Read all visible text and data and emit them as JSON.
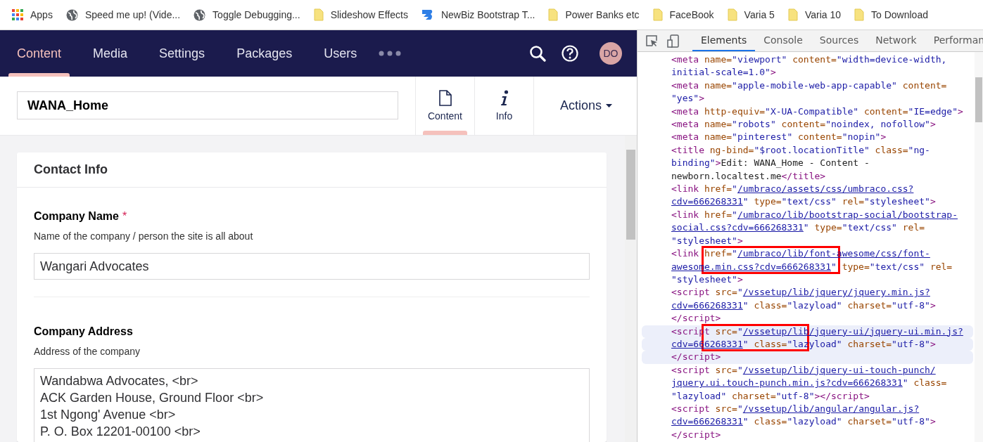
{
  "bookmarks": [
    {
      "kind": "apps",
      "label": "Apps"
    },
    {
      "kind": "page",
      "label": "Speed me up! (Vide..."
    },
    {
      "kind": "page",
      "label": "Toggle Debugging..."
    },
    {
      "kind": "folder",
      "label": "Slideshow Effects"
    },
    {
      "kind": "site",
      "label": "NewBiz Bootstrap T..."
    },
    {
      "kind": "folder",
      "label": "Power Banks etc"
    },
    {
      "kind": "folder",
      "label": "FaceBook"
    },
    {
      "kind": "folder",
      "label": "Varia 5"
    },
    {
      "kind": "folder",
      "label": "Varia 10"
    },
    {
      "kind": "folder",
      "label": "To Download"
    }
  ],
  "nav": {
    "items": [
      {
        "label": "Content",
        "selected": true
      },
      {
        "label": "Media",
        "selected": false
      },
      {
        "label": "Settings",
        "selected": false
      },
      {
        "label": "Packages",
        "selected": false
      },
      {
        "label": "Users",
        "selected": false
      }
    ],
    "avatar": "DO"
  },
  "editor": {
    "name": "WANA_Home",
    "apps": [
      {
        "label": "Content",
        "kind": "document",
        "selected": true
      },
      {
        "label": "Info",
        "kind": "info",
        "selected": false
      }
    ],
    "actions": "Actions"
  },
  "group": {
    "title": "Contact Info",
    "properties": [
      {
        "kind": "text",
        "label": "Company Name",
        "required_mark": "*",
        "description": "Name of the company / person the site is all about",
        "value": "Wangari Advocates"
      },
      {
        "kind": "textarea",
        "label": "Company Address",
        "description": "Address of the company",
        "value": "Wandabwa Advocates, <br>\nACK Garden House, Ground Floor <br>\n1st Ngong' Avenue <br>\nP. O. Box 12201-00100 <br>"
      }
    ]
  },
  "devtools": {
    "tabs": [
      {
        "label": "Elements",
        "selected": true
      },
      {
        "label": "Console",
        "selected": false
      },
      {
        "label": "Sources",
        "selected": false
      },
      {
        "label": "Network",
        "selected": false
      },
      {
        "label": "Performan",
        "selected": false
      }
    ],
    "lines": [
      {
        "selected": false,
        "tokens": [
          {
            "kind": "tag",
            "text": "<meta"
          },
          {
            "kind": "attr",
            "text": " name="
          },
          {
            "kind": "val",
            "text": "\"viewport\""
          },
          {
            "kind": "attr",
            "text": " content="
          },
          {
            "kind": "val",
            "text": "\"width=device-width,"
          }
        ]
      },
      {
        "selected": false,
        "tokens": [
          {
            "kind": "val",
            "text": "initial-scale=1.0\""
          },
          {
            "kind": "tag",
            "text": ">"
          }
        ]
      },
      {
        "selected": false,
        "tokens": [
          {
            "kind": "tag",
            "text": "<meta"
          },
          {
            "kind": "attr",
            "text": " name="
          },
          {
            "kind": "val",
            "text": "\"apple-mobile-web-app-capable\""
          },
          {
            "kind": "attr",
            "text": " content="
          }
        ]
      },
      {
        "selected": false,
        "tokens": [
          {
            "kind": "val",
            "text": "\"yes\""
          },
          {
            "kind": "tag",
            "text": ">"
          }
        ]
      },
      {
        "selected": false,
        "tokens": [
          {
            "kind": "tag",
            "text": "<meta"
          },
          {
            "kind": "attr",
            "text": " http-equiv="
          },
          {
            "kind": "val",
            "text": "\"X-UA-Compatible\""
          },
          {
            "kind": "attr",
            "text": " content="
          },
          {
            "kind": "val",
            "text": "\"IE=edge\""
          },
          {
            "kind": "tag",
            "text": ">"
          }
        ]
      },
      {
        "selected": false,
        "tokens": [
          {
            "kind": "tag",
            "text": "<meta"
          },
          {
            "kind": "attr",
            "text": " name="
          },
          {
            "kind": "val",
            "text": "\"robots\""
          },
          {
            "kind": "attr",
            "text": " content="
          },
          {
            "kind": "val",
            "text": "\"noindex, nofollow\""
          },
          {
            "kind": "tag",
            "text": ">"
          }
        ]
      },
      {
        "selected": false,
        "tokens": [
          {
            "kind": "tag",
            "text": "<meta"
          },
          {
            "kind": "attr",
            "text": " name="
          },
          {
            "kind": "val",
            "text": "\"pinterest\""
          },
          {
            "kind": "attr",
            "text": " content="
          },
          {
            "kind": "val",
            "text": "\"nopin\""
          },
          {
            "kind": "tag",
            "text": ">"
          }
        ]
      },
      {
        "selected": false,
        "tokens": [
          {
            "kind": "tag",
            "text": "<title"
          },
          {
            "kind": "attr",
            "text": " ng-bind="
          },
          {
            "kind": "val",
            "text": "\"$root.locationTitle\""
          },
          {
            "kind": "attr",
            "text": " class="
          },
          {
            "kind": "val",
            "text": "\"ng-"
          }
        ]
      },
      {
        "selected": false,
        "tokens": [
          {
            "kind": "val",
            "text": "binding\""
          },
          {
            "kind": "tag",
            "text": ">"
          },
          {
            "kind": "text",
            "text": "Edit: WANA_Home - Content -"
          }
        ]
      },
      {
        "selected": false,
        "tokens": [
          {
            "kind": "text",
            "text": "newborn.localtest.me"
          },
          {
            "kind": "tag",
            "text": "</title>"
          }
        ]
      },
      {
        "selected": false,
        "tokens": [
          {
            "kind": "tag",
            "text": "<link"
          },
          {
            "kind": "attr",
            "text": " href="
          },
          {
            "kind": "val",
            "text": "\""
          },
          {
            "kind": "link",
            "text": "/umbraco/assets/css/umbraco.css?"
          }
        ]
      },
      {
        "selected": false,
        "tokens": [
          {
            "kind": "link",
            "text": "cdv=666268331"
          },
          {
            "kind": "val",
            "text": "\""
          },
          {
            "kind": "attr",
            "text": " type="
          },
          {
            "kind": "val",
            "text": "\"text/css\""
          },
          {
            "kind": "attr",
            "text": " rel="
          },
          {
            "kind": "val",
            "text": "\"stylesheet\""
          },
          {
            "kind": "tag",
            "text": ">"
          }
        ]
      },
      {
        "selected": false,
        "tokens": [
          {
            "kind": "tag",
            "text": "<link"
          },
          {
            "kind": "attr",
            "text": " href="
          },
          {
            "kind": "val",
            "text": "\""
          },
          {
            "kind": "link",
            "text": "/umbraco/lib/bootstrap-social/bootstrap-"
          }
        ]
      },
      {
        "selected": false,
        "tokens": [
          {
            "kind": "link",
            "text": "social.css?cdv=666268331"
          },
          {
            "kind": "val",
            "text": "\""
          },
          {
            "kind": "attr",
            "text": " type="
          },
          {
            "kind": "val",
            "text": "\"text/css\""
          },
          {
            "kind": "attr",
            "text": " rel="
          }
        ]
      },
      {
        "selected": false,
        "tokens": [
          {
            "kind": "val",
            "text": "\"stylesheet\""
          },
          {
            "kind": "tag",
            "text": ">"
          }
        ]
      },
      {
        "selected": false,
        "tokens": [
          {
            "kind": "tag",
            "text": "<link"
          },
          {
            "kind": "attr",
            "text": " href="
          },
          {
            "kind": "val",
            "text": "\""
          },
          {
            "kind": "link",
            "text": "/umbraco/lib/font-awesome/css/font-"
          }
        ]
      },
      {
        "selected": false,
        "tokens": [
          {
            "kind": "link",
            "text": "awesome.min.css?cdv=666268331"
          },
          {
            "kind": "val",
            "text": "\""
          },
          {
            "kind": "attr",
            "text": " type="
          },
          {
            "kind": "val",
            "text": "\"text/css\""
          },
          {
            "kind": "attr",
            "text": " rel="
          }
        ]
      },
      {
        "selected": false,
        "tokens": [
          {
            "kind": "val",
            "text": "\"stylesheet\""
          },
          {
            "kind": "tag",
            "text": ">"
          }
        ]
      },
      {
        "selected": false,
        "tokens": [
          {
            "kind": "tag",
            "text": "<script"
          },
          {
            "kind": "attr",
            "text": " src="
          },
          {
            "kind": "val",
            "text": "\""
          },
          {
            "kind": "link",
            "text": "/vssetup/lib/jquery/jquery.min.js?"
          }
        ]
      },
      {
        "selected": false,
        "tokens": [
          {
            "kind": "link",
            "text": "cdv=666268331"
          },
          {
            "kind": "val",
            "text": "\""
          },
          {
            "kind": "attr",
            "text": " class="
          },
          {
            "kind": "val",
            "text": "\"lazyload\""
          },
          {
            "kind": "attr",
            "text": " charset="
          },
          {
            "kind": "val",
            "text": "\"utf-8\""
          },
          {
            "kind": "tag",
            "text": ">"
          }
        ]
      },
      {
        "selected": false,
        "tokens": [
          {
            "kind": "tag",
            "text": "</script>"
          }
        ]
      },
      {
        "selected": true,
        "tokens": [
          {
            "kind": "tag",
            "text": "<script"
          },
          {
            "kind": "attr",
            "text": " src="
          },
          {
            "kind": "val",
            "text": "\""
          },
          {
            "kind": "link",
            "text": "/vssetup/lib/jquery-ui/jquery-ui.min.js?"
          }
        ]
      },
      {
        "selected": true,
        "tokens": [
          {
            "kind": "link",
            "text": "cdv=666268331"
          },
          {
            "kind": "val",
            "text": "\""
          },
          {
            "kind": "attr",
            "text": " class="
          },
          {
            "kind": "val",
            "text": "\"lazyload\""
          },
          {
            "kind": "attr",
            "text": " charset="
          },
          {
            "kind": "val",
            "text": "\"utf-8\""
          },
          {
            "kind": "tag",
            "text": ">"
          }
        ]
      },
      {
        "selected": true,
        "tokens": [
          {
            "kind": "tag",
            "text": "</script>"
          }
        ]
      },
      {
        "selected": false,
        "tokens": [
          {
            "kind": "tag",
            "text": "<script"
          },
          {
            "kind": "attr",
            "text": " src="
          },
          {
            "kind": "val",
            "text": "\""
          },
          {
            "kind": "link",
            "text": "/vssetup/lib/jquery-ui-touch-punch/"
          }
        ]
      },
      {
        "selected": false,
        "tokens": [
          {
            "kind": "link",
            "text": "jquery.ui.touch-punch.min.js?cdv=666268331"
          },
          {
            "kind": "val",
            "text": "\""
          },
          {
            "kind": "attr",
            "text": " class="
          }
        ]
      },
      {
        "selected": false,
        "tokens": [
          {
            "kind": "val",
            "text": "\"lazyload\""
          },
          {
            "kind": "attr",
            "text": " charset="
          },
          {
            "kind": "val",
            "text": "\"utf-8\""
          },
          {
            "kind": "tag",
            "text": "></script>"
          }
        ]
      },
      {
        "selected": false,
        "tokens": [
          {
            "kind": "tag",
            "text": "<script"
          },
          {
            "kind": "attr",
            "text": " src="
          },
          {
            "kind": "val",
            "text": "\""
          },
          {
            "kind": "link",
            "text": "/vssetup/lib/angular/angular.js?"
          }
        ]
      },
      {
        "selected": false,
        "tokens": [
          {
            "kind": "link",
            "text": "cdv=666268331"
          },
          {
            "kind": "val",
            "text": "\""
          },
          {
            "kind": "attr",
            "text": " class="
          },
          {
            "kind": "val",
            "text": "\"lazyload\""
          },
          {
            "kind": "attr",
            "text": " charset="
          },
          {
            "kind": "val",
            "text": "\"utf-8\""
          },
          {
            "kind": "tag",
            "text": ">"
          }
        ]
      },
      {
        "selected": false,
        "tokens": [
          {
            "kind": "tag",
            "text": "</script>"
          }
        ]
      }
    ],
    "annotations": [
      {
        "kind": "box",
        "color": "#ff0000"
      },
      {
        "kind": "box",
        "color": "#ff0000"
      }
    ]
  }
}
